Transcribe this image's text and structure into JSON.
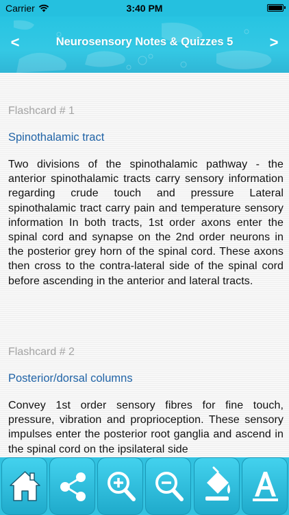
{
  "status": {
    "carrier": "Carrier",
    "time": "3:40 PM"
  },
  "nav": {
    "title": "Neurosensory Notes & Quizzes 5",
    "prev_label": "<",
    "next_label": ">"
  },
  "cards": [
    {
      "number": "Flashcard # 1",
      "title": "Spinothalamic tract",
      "body": "Two divisions of the spinothalamic pathway - the anterior spinothalamic tracts carry sensory information regarding crude touch and pressure Lateral spinothalamic tract carry pain and temperature sensory information In both tracts, 1st order axons enter the spinal cord and synapse on the 2nd order neurons in the posterior grey horn of the spinal cord. These axons then cross to the contra-lateral side of the spinal cord before ascending in the anterior and lateral tracts."
    },
    {
      "number": "Flashcard # 2",
      "title": "Posterior/dorsal columns",
      "body": "Convey 1st order sensory fibres for fine touch, pressure, vibration and proprioception. These sensory impulses enter the posterior root ganglia and ascend in the spinal cord on the ipsilateral side"
    }
  ],
  "toolbar": {
    "buttons": [
      {
        "icon": "home-icon"
      },
      {
        "icon": "share-icon"
      },
      {
        "icon": "zoom-in-icon"
      },
      {
        "icon": "zoom-out-icon"
      },
      {
        "icon": "paint-bucket-icon"
      },
      {
        "icon": "font-icon"
      }
    ]
  }
}
